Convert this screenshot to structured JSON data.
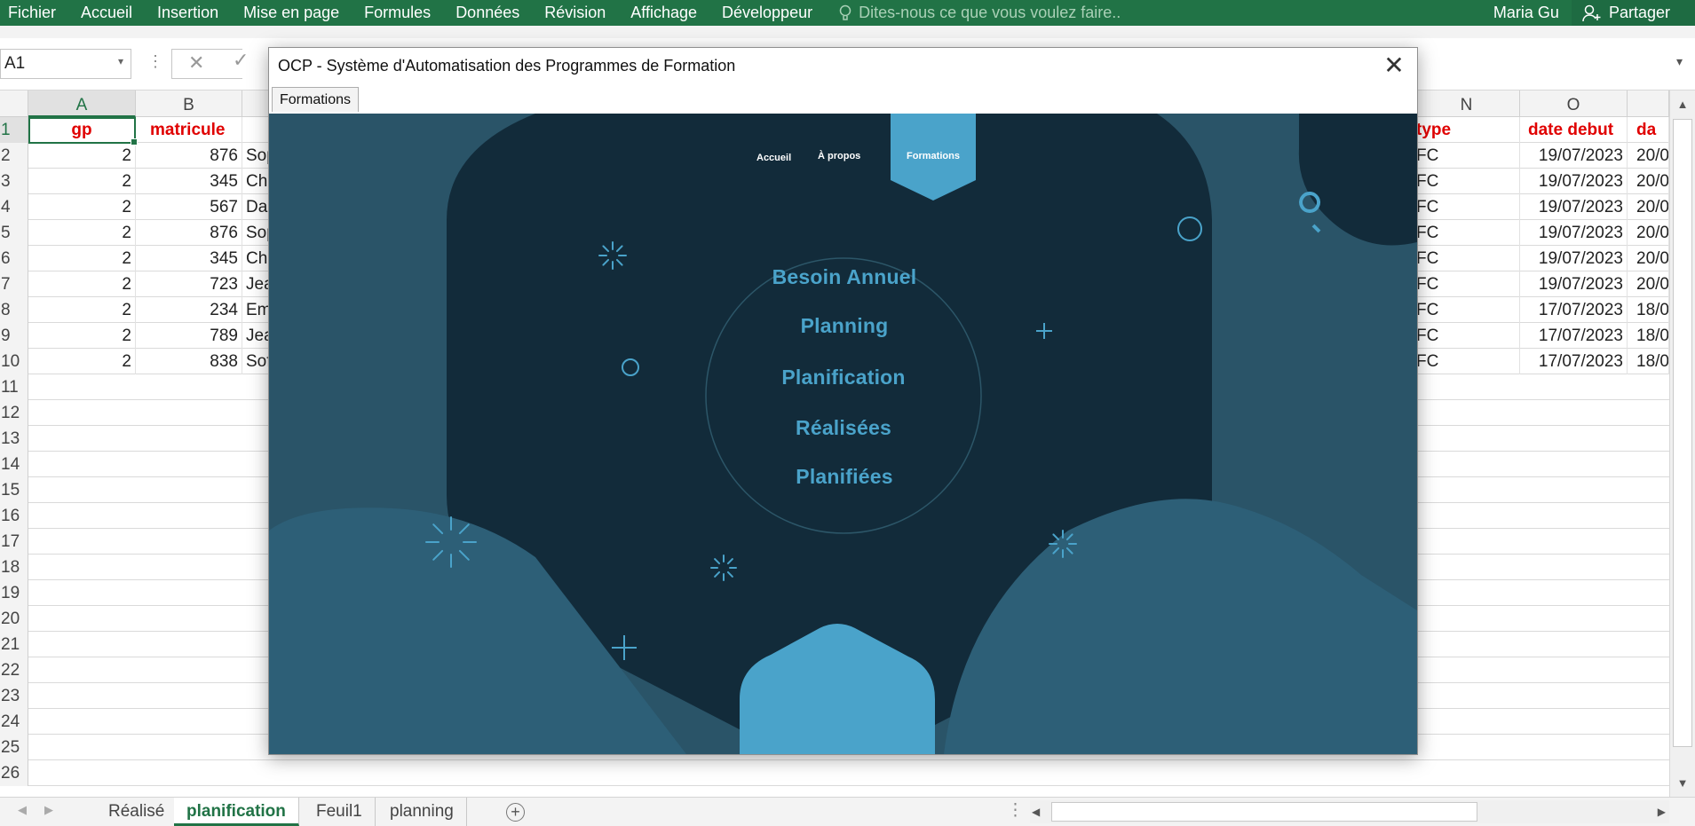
{
  "ribbon": {
    "tabs": [
      "Fichier",
      "Accueil",
      "Insertion",
      "Mise en page",
      "Formules",
      "Données",
      "Révision",
      "Affichage",
      "Développeur"
    ],
    "tell_me": "Dites-nous ce que vous voulez faire..",
    "user": "Maria Gu",
    "share": "Partager"
  },
  "formula_bar": {
    "name_box": "A1",
    "formula": ""
  },
  "columns": [
    "A",
    "B",
    "N",
    "O"
  ],
  "headers": {
    "gp": "gp",
    "matricule": "matricule",
    "type": "type",
    "date_debut": "date debut",
    "date_fin_partial": "da"
  },
  "rows": [
    {
      "n": "2",
      "gp": "2",
      "mat": "876",
      "name": "Sop",
      "type": "FC",
      "deb": "19/07/2023",
      "fin": "20/0"
    },
    {
      "n": "3",
      "gp": "2",
      "mat": "345",
      "name": "Ch",
      "type": "FC",
      "deb": "19/07/2023",
      "fin": "20/0"
    },
    {
      "n": "4",
      "gp": "2",
      "mat": "567",
      "name": "Da",
      "type": "FC",
      "deb": "19/07/2023",
      "fin": "20/0"
    },
    {
      "n": "5",
      "gp": "2",
      "mat": "876",
      "name": "Sop",
      "type": "FC",
      "deb": "19/07/2023",
      "fin": "20/0"
    },
    {
      "n": "6",
      "gp": "2",
      "mat": "345",
      "name": "Ch",
      "type": "FC",
      "deb": "19/07/2023",
      "fin": "20/0"
    },
    {
      "n": "7",
      "gp": "2",
      "mat": "723",
      "name": "Jea",
      "type": "FC",
      "deb": "19/07/2023",
      "fin": "20/0"
    },
    {
      "n": "8",
      "gp": "2",
      "mat": "234",
      "name": "Em",
      "type": "FC",
      "deb": "17/07/2023",
      "fin": "18/0"
    },
    {
      "n": "9",
      "gp": "2",
      "mat": "789",
      "name": "Jea",
      "type": "FC",
      "deb": "17/07/2023",
      "fin": "18/0"
    },
    {
      "n": "10",
      "gp": "2",
      "mat": "838",
      "name": "Sof",
      "type": "FC",
      "deb": "17/07/2023",
      "fin": "18/0"
    }
  ],
  "empty_rows": [
    "11",
    "12",
    "13",
    "14",
    "15",
    "16",
    "17",
    "18",
    "19",
    "20",
    "21",
    "22",
    "23",
    "24",
    "25",
    "26"
  ],
  "sheets": [
    "Réalisé",
    "planification",
    "Feuil1",
    "planning"
  ],
  "active_sheet": "planification",
  "dialog": {
    "title": "OCP - Système d'Automatisation des Programmes de Formation",
    "tab": "Formations",
    "nav": {
      "home": "Accueil",
      "about": "À propos",
      "formations": "Formations"
    },
    "menu": [
      "Besoin Annuel",
      "Planning",
      "Planification",
      "Réalisées",
      "Planifiées"
    ]
  },
  "colors": {
    "excel_green": "#217346",
    "header_red": "#e00000",
    "stage_dark": "#122b3a",
    "stage_mid": "#2a5468",
    "accent_blue": "#4aa3ca"
  }
}
